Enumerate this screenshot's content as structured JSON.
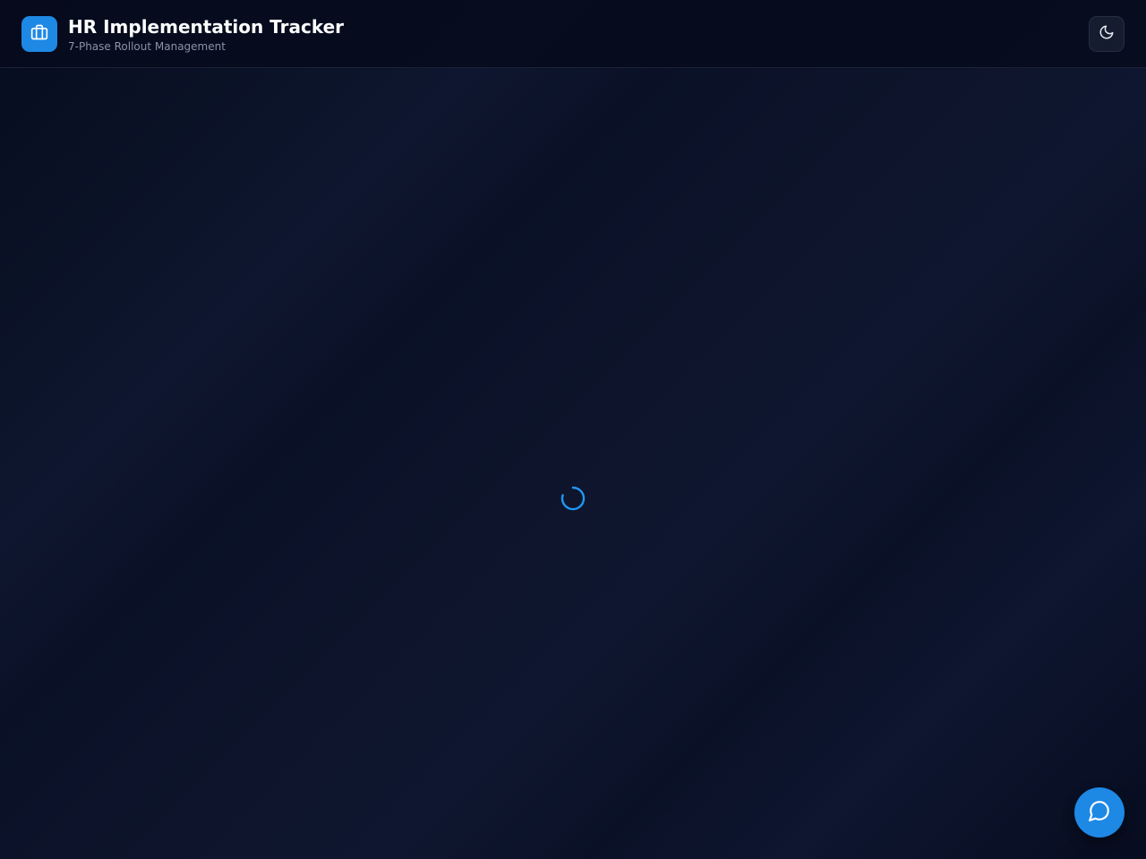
{
  "header": {
    "title": "HR Implementation Tracker",
    "subtitle": "7-Phase Rollout Management",
    "logo_icon": "briefcase-icon",
    "theme_toggle_icon": "moon-icon"
  },
  "main": {
    "loading_indicator": "spinner-icon"
  },
  "chat": {
    "icon": "chat-bubble-icon"
  },
  "colors": {
    "accent": "#1e88e5",
    "background": "#0b1226",
    "header_bg": "#060a1c",
    "title_text": "#ffffff",
    "subtitle_text": "#8a93a8"
  }
}
